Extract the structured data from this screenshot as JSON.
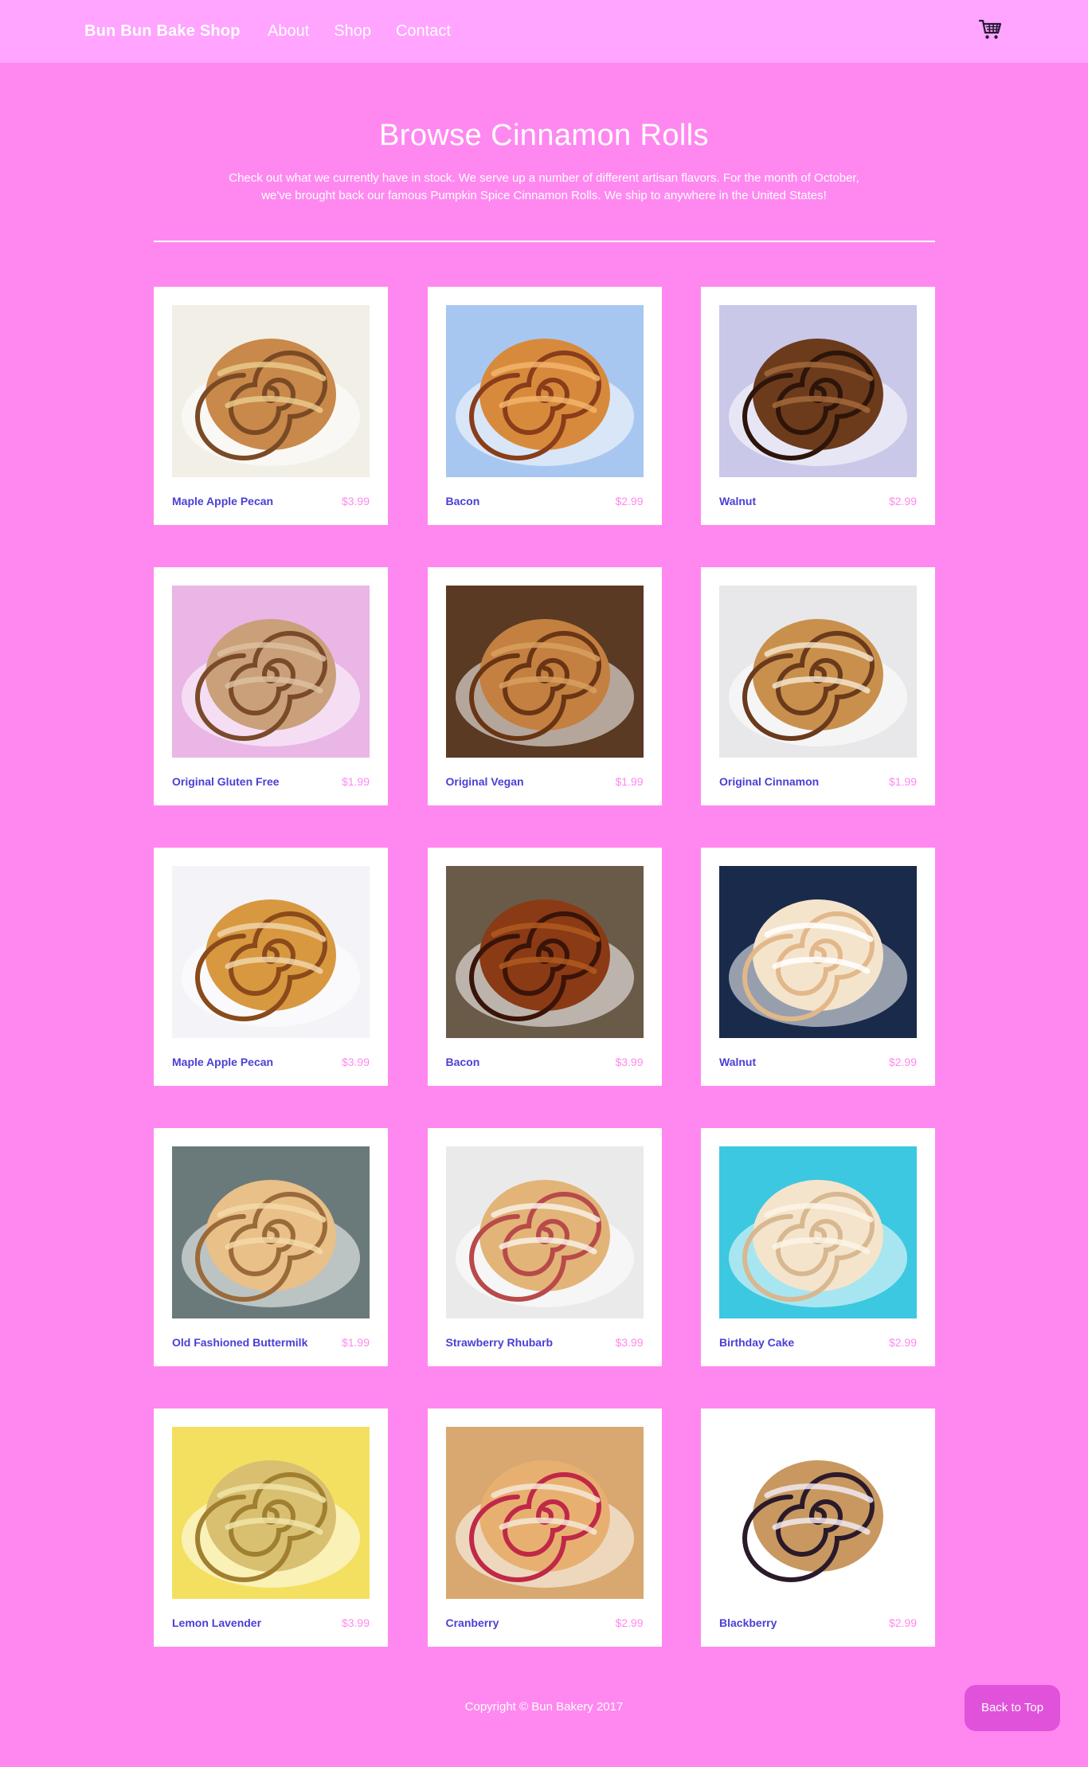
{
  "nav": {
    "brand": "Bun Bun Bake Shop",
    "links": [
      "About",
      "Shop",
      "Contact"
    ],
    "cart_icon": "shopping-cart-icon"
  },
  "hero": {
    "title": "Browse Cinnamon Rolls",
    "description_line1": "Check out what we currently have in stock. We serve up a number of different artisan flavors. For the month of October,",
    "description_line2": "we've brought back our famous Pumpkin Spice Cinnamon Rolls. We ship to anywhere in the United States!"
  },
  "products": [
    {
      "name": "Maple Apple Pecan",
      "price": "$3.99",
      "bg": "#f2efe6",
      "roll": "#c8894a",
      "swirl": "#7a4a25",
      "glaze": "#e9c98a"
    },
    {
      "name": "Bacon",
      "price": "$2.99",
      "bg": "#a8c7f0",
      "roll": "#d88a3c",
      "swirl": "#8a3d1a",
      "glaze": "#f2b46a"
    },
    {
      "name": "Walnut",
      "price": "$2.99",
      "bg": "#c9c8e8",
      "roll": "#6b3b1c",
      "swirl": "#2e150a",
      "glaze": "#a46a3a"
    },
    {
      "name": "Original Gluten Free",
      "price": "$1.99",
      "bg": "#e9b6e6",
      "roll": "#c9a07a",
      "swirl": "#7a4a2a",
      "glaze": "#dcc0a0"
    },
    {
      "name": "Original Vegan",
      "price": "$1.99",
      "bg": "#5a3a22",
      "roll": "#c48040",
      "swirl": "#6a3514",
      "glaze": "#d8a060"
    },
    {
      "name": "Original Cinnamon",
      "price": "$1.99",
      "bg": "#e8e8ea",
      "roll": "#c8904c",
      "swirl": "#6a3a1c",
      "glaze": "#f4e4cc"
    },
    {
      "name": "Maple Apple Pecan",
      "price": "$3.99",
      "bg": "#f4f4f8",
      "roll": "#d89840",
      "swirl": "#8a4a1a",
      "glaze": "#f0d4a8"
    },
    {
      "name": "Bacon",
      "price": "$3.99",
      "bg": "#6a5a48",
      "roll": "#8a3a14",
      "swirl": "#3a1408",
      "glaze": "#b05a20"
    },
    {
      "name": "Walnut",
      "price": "$2.99",
      "bg": "#1a2a4a",
      "roll": "#f4e4cc",
      "swirl": "#e2b88a",
      "glaze": "#ffffff"
    },
    {
      "name": "Old Fashioned Buttermilk",
      "price": "$1.99",
      "bg": "#6a7a7a",
      "roll": "#e8c088",
      "swirl": "#9a6a3a",
      "glaze": "#f4d8a8"
    },
    {
      "name": "Strawberry Rhubarb",
      "price": "$3.99",
      "bg": "#eaeaea",
      "roll": "#e2b478",
      "swirl": "#b84a4a",
      "glaze": "#f8f0e4"
    },
    {
      "name": "Birthday Cake",
      "price": "$2.99",
      "bg": "#3cc8e0",
      "roll": "#f4e4cc",
      "swirl": "#d8b890",
      "glaze": "#fbf4e8"
    },
    {
      "name": "Lemon Lavender",
      "price": "$3.99",
      "bg": "#f4e060",
      "roll": "#d8c070",
      "swirl": "#a08030",
      "glaze": "#f0e4a8"
    },
    {
      "name": "Cranberry",
      "price": "$2.99",
      "bg": "#d8a870",
      "roll": "#e8b070",
      "swirl": "#c02848",
      "glaze": "#f4e8d4"
    },
    {
      "name": "Blackberry",
      "price": "$2.99",
      "bg": "#ffffff",
      "roll": "#c89860",
      "swirl": "#2a1a2a",
      "glaze": "#f0e8f0"
    }
  ],
  "footer": {
    "copyright": "Copyright © Bun Bakery 2017",
    "back_to_top": "Back to Top"
  }
}
